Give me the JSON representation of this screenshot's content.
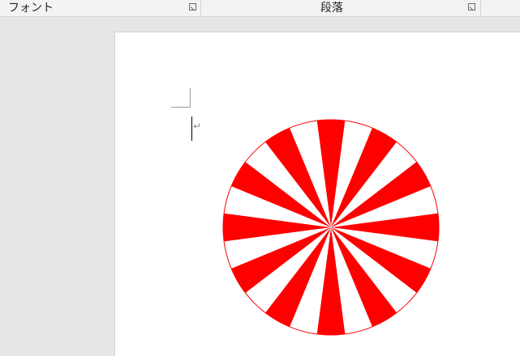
{
  "ribbon": {
    "groups": [
      {
        "label": "フォント"
      },
      {
        "label": "段落"
      }
    ]
  },
  "document": {
    "paragraph_mark": "↵"
  },
  "shape": {
    "type": "sunburst",
    "stripes": 24,
    "fill_color": "#ff0000",
    "alt_color": "#ffffff",
    "outline_color": "#ff0000"
  }
}
